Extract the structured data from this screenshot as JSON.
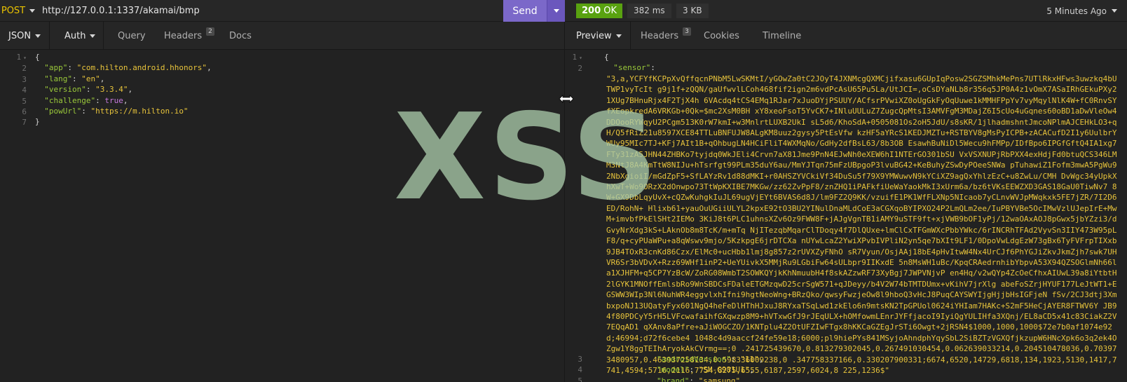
{
  "request": {
    "method": "POST",
    "url": "http://127.0.0.1:1337/akamai/bmp",
    "send_label": "Send",
    "tabs": [
      {
        "label": "JSON"
      },
      {
        "label": "Auth"
      },
      {
        "label": "Query"
      },
      {
        "label": "Headers",
        "badge": "2"
      },
      {
        "label": "Docs"
      }
    ],
    "body_lines": [
      "1",
      "2",
      "3",
      "4",
      "5",
      "6",
      "7"
    ],
    "body": {
      "app": "\"com.hilton.android.hhonors\"",
      "lang": "\"en\"",
      "version": "\"3.3.4\"",
      "challenge": "true",
      "powUrl": "\"https://m.hilton.io\""
    }
  },
  "response": {
    "status_code": "200",
    "status_text": "OK",
    "time": "382 ms",
    "size": "3 KB",
    "ago": "5 Minutes Ago",
    "tabs": [
      {
        "label": "Preview"
      },
      {
        "label": "Headers",
        "badge": "3"
      },
      {
        "label": "Cookies"
      },
      {
        "label": "Timeline"
      }
    ],
    "line_numbers": {
      "l1": "1",
      "l2": "2",
      "l3": "3",
      "l4": "4",
      "l5": "5"
    },
    "sensor_key": "\"sensor\"",
    "sensor_value": "\"3,a,YCFYfKCPpXvQffqcnPNbM5LwSKMtI/yGOwZa0tC2JOyT4JXNMcgQXMCjifxasu6GUpIqPosw2SGZSMhkMePns7UTlRkxHFws3uwzkq4bUTWP1vyTcIt g9j1f+zQQN/gaUfwvlLCoh468fif2ign2m6vdPcAsU65Pu5La/UtJCI=,oCsDYaNLb8r356q5JP0A4z1vOmX7ASaIRhGEkuPXy21XUg7BHnuRjx4F2TjX4h 6VAcdq4tCS4EMq1RJar7xJuoDYjPSUUY/ACfsrPVwiXZ0oUgGkFyOqUuwe1kMMHFPpYv7vyMqylNlK4W+fC0RnvSYfXEopkredA6VRKGb+0Qk=$mc2XsM0BH xY8xeoFsoT5YvCK7+INluUULuZ7ZugcQpMtsI3AMVFgM3MDajZ6I5cUo4uGqnes60oBD1aDwVleOw4DDOooRYWqyU2PCgm513K0rW7kmI+w3MnlrtLUXB2UkI sL5d6/KhoSdA+0505081Os2oH5JdU/s8sKR/1jlhadmshntJmcoNPlmAJCEHkLO3+qH/Q5fRiZ21u8597XCE84TTLuBNFUJW8ALgKM8uuz2gysy5PtEsVfw kzHF5aYRcS1KEDJMZTu+RSTBYV8gMsPyICPB+zACACufD2I1y6UulbrYWUy95MIc7TJ+KFj7AIt1B+qOhbugLN4HCiFliT4WXMqNo/GdHy2dfBsL63/8b3OB EsawhBuNiDl5Wecu9hFMPp/IDfBpo6IPGfGftQ4IA1xg7FTy31zA5JHN44ZHBKo7tyjdq0WkJEli4Crvn7aX81Jme9PnN4EJwNh0eXEW6hI1NTErGO301bSU VxVSXNUPjRbPXX4exHdjFd0btuQCS346LMM3NtJ8A4KmTtW8NIJu+hTsrfgt99PLm35duY6au/MmYJTqn75mFzUBpgoP3lvuBG42+KeBuhyZSwDyPOeeSNWa pTuhawiZ1Fofm3mwA5PgWu92NbXgioiI/mGdZpF5+SfLAYzRv1d88dMKI+r0AHSZYVCkiVf34DuSu5f79X9YMWuwvN9kYCiXZ9agQxYhlzEzC+u8ZwLu/CMH DvWgc34yUpkXhXwT+Wo9ORzX2dOnwpo73TtWpKXIBE7MKGw/zz62ZvPpF8/znZHQ1iPAFkfiUeWaYaokMkI3xUrm6a/bz6tVKsEEWZXD3GAS18GaU0TiwNv7 8W+GX9DbLqyUvX+cQZwKuhgkIuJL69ugVjEYt6BVAS6d8J/lm9FZ2Q9KK/vzuifE1PK1WfFLXNp5NIcaob7yCLnvWVJpMWqkxk5FE7jZR/7I2D6ED/RohN+ Hlixb61+yauOuUGiiULYL2kpxE92tO3BU2YINulDnaMLdCoE3aCGXqoBYIPXO24P2LmQLm2ee/IuPBYVBe5OcIMwVzlUJepIrE+MwM+imvbfPkElSHt2IEMo 3KiJ8t6PLC1uhnsXZv6Oz9FWW8F+jAJgVgnTB1iAMY9uSTF9ft+xjVWB9bOF1yPj/12waOAxAOJ8pGwx5jbYZzi3/dGvyNrXdg3kS+LAknOb8m8TcK/m+mTq NjITezqbMqarClTDoqy4f7DlQUxe+lmClCxTFGmWXcPbbYWkc/6rINCRhTFAd2VyvSn3IIY473W95pLF8/q+cyPUaWPu+a8qWswv9mjo/5KzkpgE6jrDTCXa nUYwLcaZ2YwiXPvbIVPliN2yn5qe7bXIt9LF1/0DpoVwLdgEzW73gBx6TyFVFrpTIXxb9JB4TOxR3cnKd86Czx/ElMc0+ucHbb1lmj8g857z2rUVXZyFNhO sR7Vyun/OsjAAj18bE4pHvItwW4Nx4UrCJf6PhYGJiZkvJkmZjh7swk7UHVR6Sr3bVDvX+Rzz69WHf1inP2+UeYUivkX5MMjRu9LGbiFw64sULbpr9IIKxdE 5n8MsWH1uBc/KpqCRAedrnhibYbpvA53X94QZSOGlmNh66la1XJHFM+q5CP7YzBcW/ZoRG08WmbT2SOWKQYjkKhNmuubH4f8skAZzwRF73XyBgj7JWPVNjvP en4Hq/v2wQYp4ZcOeCfhxAIUwL39a8iYtbtH2lGYK1MNOffEmlsbRo9WnSBDCsFDaleETGMzqwD25crSgW571+qJDeyy/b4V2W74bTMTDUmx+vKihV7jrXlg abeFoSZrjHYUF177LeJtWT1+EGSWW3WIp3Nl6NuhWR4eggvlxhIfni9hgtNeoWng+BRzQko/qwsyFwzjeOw8l9hboQ3vHcJ8PuqCAYSWYIjgHjjbHsIGFjeN fSv/2CJ3dtj3XmbxpoNJ13UQatyFyx601NgQ4heFeDlHThHJxuJ8RYxaTSqLwd1zkElo6n9mtsKN2TpGPUol0624iYHIam7HAKc+S2mF5HeCjAYER8FTWV6Y JB94f80PDCyY5rH5LVFcwafaihfGXqwzp8M9+hVTxwGfJ9rJEqULX+hOMfowmLEnrJYFfjacoI9IyiQgYULIHfa3XQnj/EL8aCD5x41c83CiakZ2V7EQqAD1 qXAnv8aPfre+aJiWOGCZO/1KNTplu4Z2OtUFZIwFTgx8hKKCaGZEgJrSTi6Owgt+2jRSN4$1000,1000,1000$72e7b0af1074e92d;46994;d72f6cebe4 1048c4d9aaccf24fe59e18;6000;pl9hiePYs841MSyjoAhndphYqySbL2SiBZTzVGXQfjkzupW6HNcXpk6o3q2ek4OZgw1Y8ggTEIhAryokAkCVrmg==;0 .241725439670,0.813279302045,0.267491030454,0.062639033214,0.204510478036,0.703973480957,0.463937258134,0.598336009238,0 .347758337166,0.330207900331;6674,6520,14729,6818,134,1923,5130,1417,7741,4594;5716,2116,7754,8275,6555,6187,2597,6024,8 225,1236$\"",
    "android_key": "\"androidVersion\"",
    "android_value": "\"11\"",
    "model_key": "\"model\"",
    "model_value": "\"SM-G981U1\"",
    "brand_key": "\"brand\"",
    "brand_value": "\"samsung\""
  },
  "watermark": "XSS",
  "colors": {
    "send_button": "#7b68c9",
    "status_ok": "#59a210",
    "method": "#ebc400",
    "json_key": "#9ac83a",
    "json_string": "#e7c33b",
    "json_bool": "#c678dd"
  }
}
